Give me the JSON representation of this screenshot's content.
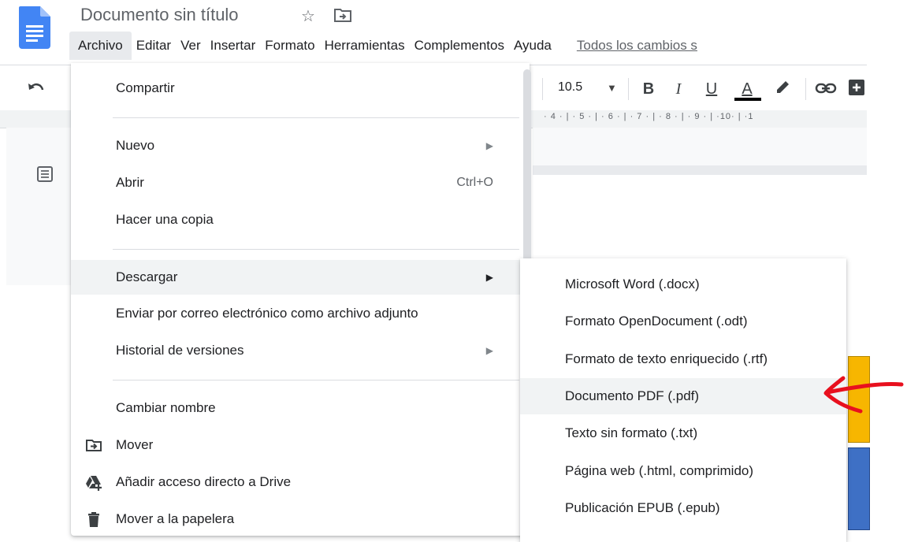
{
  "header": {
    "title": "Documento sin título",
    "saved_status": "Todos los cambios s"
  },
  "menubar": [
    {
      "label": "Archivo",
      "active": true
    },
    {
      "label": "Editar"
    },
    {
      "label": "Ver"
    },
    {
      "label": "Insertar"
    },
    {
      "label": "Formato"
    },
    {
      "label": "Herramientas"
    },
    {
      "label": "Complementos"
    },
    {
      "label": "Ayuda"
    }
  ],
  "toolbar": {
    "font_size": "10.5",
    "bold": "B",
    "italic": "I",
    "underline": "U",
    "text_color": "A",
    "ruler": "· 4 · | · 5 · | · 6 · | · 7 · | · 8 · | · 9 · | ·10· | ·1"
  },
  "file_menu": {
    "share": "Compartir",
    "new": "Nuevo",
    "open": "Abrir",
    "open_shortcut": "Ctrl+O",
    "make_copy": "Hacer una copia",
    "download": "Descargar",
    "email_attachment": "Enviar por correo electrónico como archivo adjunto",
    "version_history": "Historial de versiones",
    "rename": "Cambiar nombre",
    "move": "Mover",
    "add_shortcut": "Añadir acceso directo a Drive",
    "trash": "Mover a la papelera"
  },
  "download_submenu": [
    {
      "label": "Microsoft Word (.docx)"
    },
    {
      "label": "Formato OpenDocument (.odt)"
    },
    {
      "label": "Formato de texto enriquecido (.rtf)"
    },
    {
      "label": "Documento PDF (.pdf)",
      "highlighted": true
    },
    {
      "label": "Texto sin formato (.txt)"
    },
    {
      "label": "Página web (.html, comprimido)"
    },
    {
      "label": "Publicación EPUB (.epub)"
    }
  ],
  "colors": {
    "docs_blue": "#4285f4",
    "highlight": "#f1f3f4",
    "annotation_red": "#e8101e"
  }
}
